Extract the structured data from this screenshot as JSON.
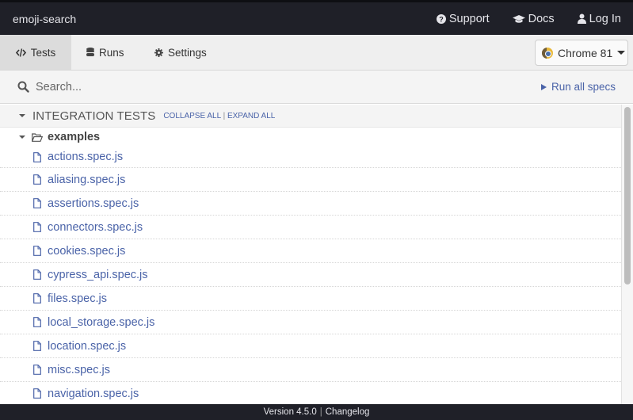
{
  "topbar": {
    "project_name": "emoji-search",
    "links": [
      {
        "label": "Support",
        "icon": "question-circle-icon"
      },
      {
        "label": "Docs",
        "icon": "graduation-cap-icon"
      },
      {
        "label": "Log In",
        "icon": "user-icon"
      }
    ]
  },
  "tabs": [
    {
      "label": "Tests",
      "icon": "code-icon",
      "active": true
    },
    {
      "label": "Runs",
      "icon": "database-icon",
      "active": false
    },
    {
      "label": "Settings",
      "icon": "gear-icon",
      "active": false
    }
  ],
  "browser_selector": {
    "label": "Chrome 81",
    "icon": "chrome-icon"
  },
  "search": {
    "placeholder": "Search...",
    "value": ""
  },
  "run_all": {
    "label": "Run all specs"
  },
  "section": {
    "title": "INTEGRATION TESTS",
    "collapse_all": "COLLAPSE ALL",
    "separator": "|",
    "expand_all": "EXPAND ALL"
  },
  "folder": {
    "name": "examples"
  },
  "files": [
    "actions.spec.js",
    "aliasing.spec.js",
    "assertions.spec.js",
    "connectors.spec.js",
    "cookies.spec.js",
    "cypress_api.spec.js",
    "files.spec.js",
    "local_storage.spec.js",
    "location.spec.js",
    "misc.spec.js",
    "navigation.spec.js"
  ],
  "footer": {
    "version": "Version 4.5.0",
    "separator": "|",
    "changelog": "Changelog"
  },
  "colors": {
    "link": "#4a63a8",
    "topbar": "#1f2028"
  }
}
